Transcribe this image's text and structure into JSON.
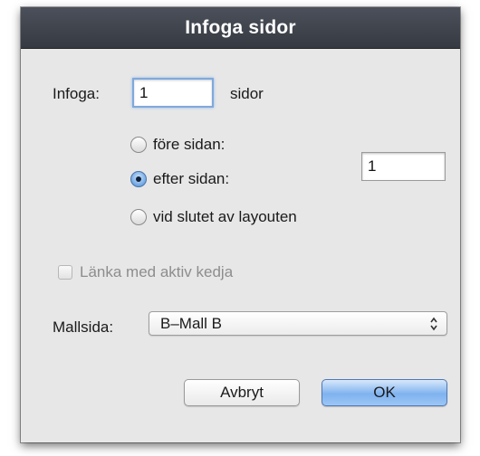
{
  "dialog": {
    "title": "Infoga sidor",
    "insert_label": "Infoga:",
    "insert_value": "1",
    "pages_label": "sidor",
    "position_options": [
      {
        "label": "före sidan:",
        "selected": false
      },
      {
        "label": "efter sidan:",
        "selected": true
      },
      {
        "label": "vid slutet av layouten",
        "selected": false
      }
    ],
    "page_number_value": "1",
    "link_checkbox": {
      "label": "Länka med aktiv kedja",
      "checked": false,
      "enabled": false
    },
    "master_label": "Mallsida:",
    "master_selected": "B–Mall B",
    "cancel_label": "Avbryt",
    "ok_label": "OK"
  },
  "icons": {
    "select_arrows": "up-down-chevron-icon"
  },
  "colors": {
    "title_bar": "#3f434b",
    "dialog_bg": "#e7e7e7",
    "focus_ring": "#7fa9dc",
    "default_button": "#7fb2ef"
  }
}
